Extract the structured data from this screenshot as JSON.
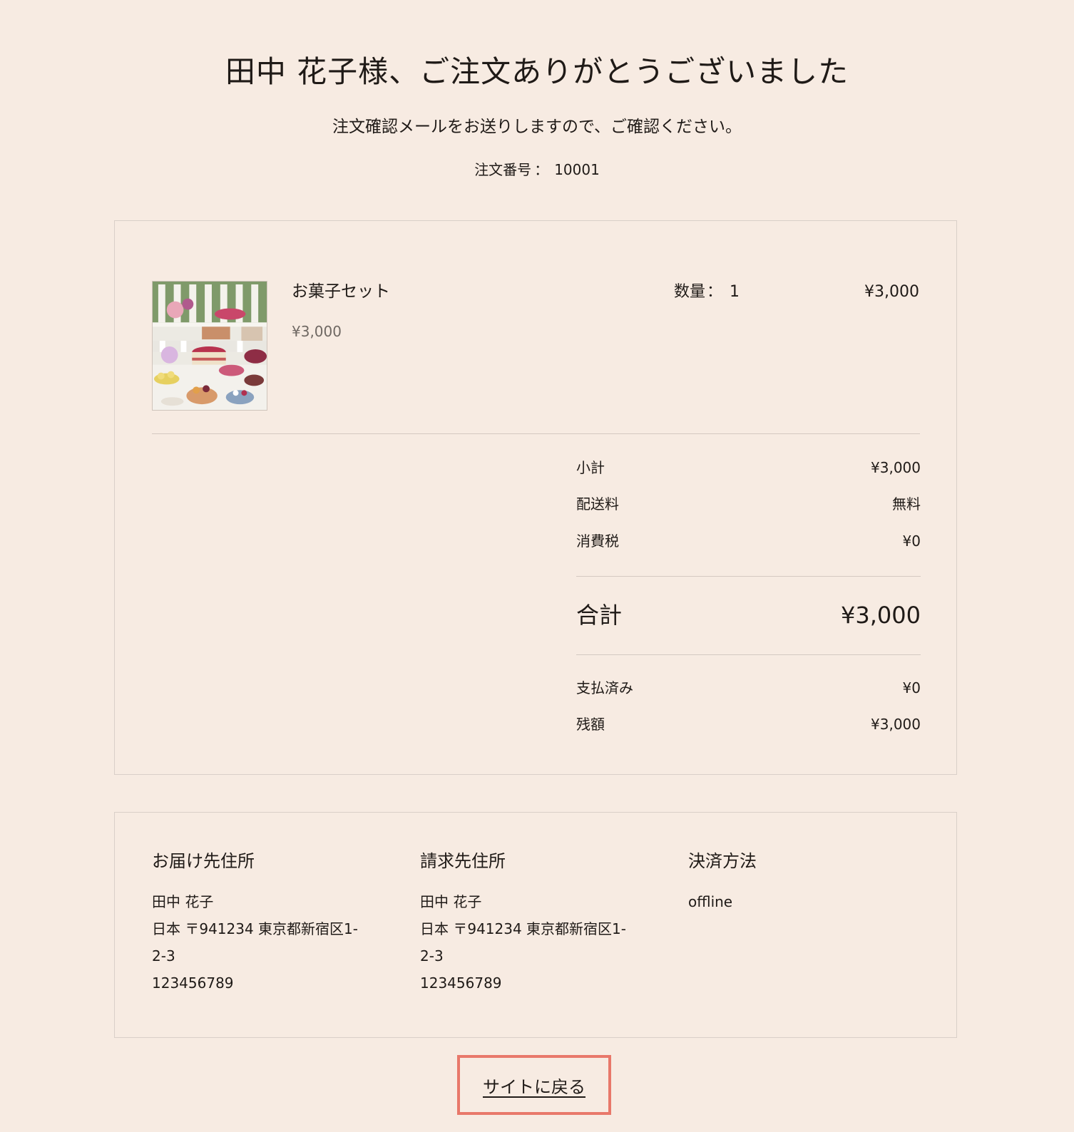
{
  "header": {
    "title": "田中 花子様、ご注文ありがとうございました",
    "message": "注文確認メールをお送りしますので、ご確認ください。",
    "order_number_label": "注文番号",
    "order_number_sep": "：",
    "order_number": "10001"
  },
  "item": {
    "name": "お菓子セット",
    "unit_price": "¥3,000",
    "quantity_label": "数量",
    "quantity_sep": "：",
    "quantity": "1",
    "line_total": "¥3,000",
    "image_icon": "dessert-table-photo"
  },
  "summary": {
    "subtotal_label": "小計",
    "subtotal": "¥3,000",
    "shipping_label": "配送料",
    "shipping": "無料",
    "tax_label": "消費税",
    "tax": "¥0",
    "total_label": "合計",
    "total": "¥3,000",
    "paid_label": "支払済み",
    "paid": "¥0",
    "balance_label": "残額",
    "balance": "¥3,000"
  },
  "shipping_address": {
    "heading": "お届け先住所",
    "name": "田中 花子",
    "line1": "日本 〒941234 東京都新宿区1-",
    "line2": "2-3",
    "phone": "123456789"
  },
  "billing_address": {
    "heading": "請求先住所",
    "name": "田中 花子",
    "line1": "日本 〒941234 東京都新宿区1-",
    "line2": "2-3",
    "phone": "123456789"
  },
  "payment": {
    "heading": "決済方法",
    "method": "offline"
  },
  "actions": {
    "back_label": "サイトに戻る"
  },
  "colors": {
    "background": "#f7ebe2",
    "text": "#1f1a17",
    "border": "#d9cfc8",
    "button_outline": "#e8786a"
  }
}
